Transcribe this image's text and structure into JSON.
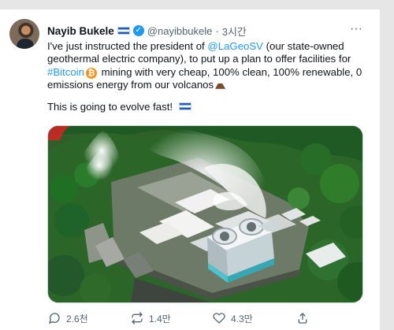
{
  "post": {
    "author_name": "Nayib Bukele",
    "handle": "@nayibbukele",
    "separator": "·",
    "time": "3시간",
    "more_label": "···",
    "text_parts": [
      "I've just instructed the president of ",
      "@LaGeoSV",
      " (our state-owned geothermal electric company), to put up a plan to offer facilities for ",
      "#Bitcoin",
      " mining with very cheap, 100% clean, 100% renewable, 0 emissions energy from our volcanos"
    ],
    "second_paragraph": "This is going to evolve fast!",
    "flag_country": "El Salvador",
    "bitcoin_icon_symbol": "₿",
    "media_alt": "Aerial view of geothermal power plant with steam rising among green forest"
  },
  "actions": {
    "comments": "2.6천",
    "retweets": "1.4만",
    "likes": "4.3만",
    "share_icon": "share-icon"
  },
  "colors": {
    "accent": "#1d9bf0",
    "muted": "#536471",
    "text": "#0f1419",
    "background": "#ffffff",
    "frame": "#e6e6e6"
  }
}
